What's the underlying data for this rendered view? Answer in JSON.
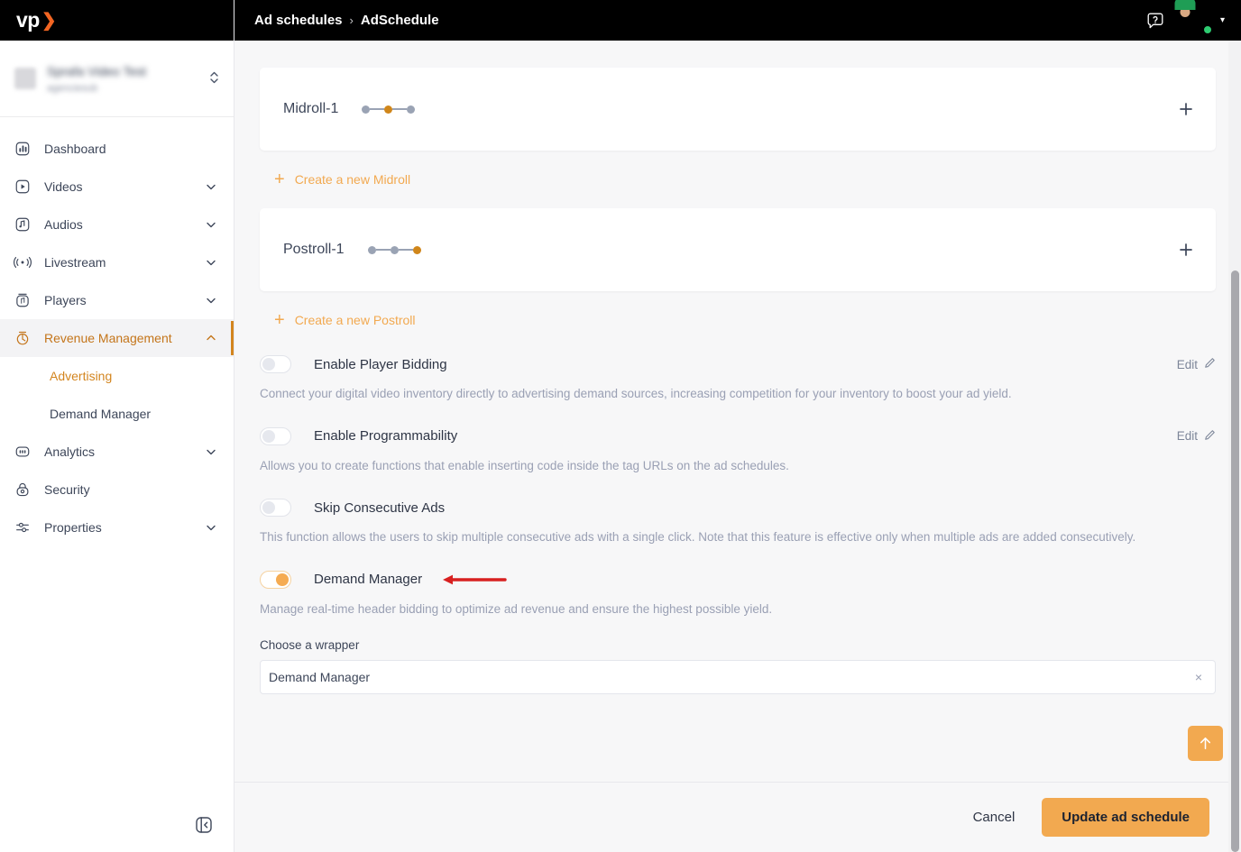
{
  "brand": {
    "logo_text": "vp",
    "logo_chevron": "❯",
    "accent": "#f2a950",
    "accent_dark": "#d3851f",
    "logo_orange": "#f26522"
  },
  "sidebar": {
    "account": {
      "name": "Sprafa Video Test",
      "sub": "agenciesub",
      "switch_icon": "chevron-updown-icon"
    },
    "items": [
      {
        "label": "Dashboard",
        "icon": "dashboard-icon",
        "expandable": false,
        "active": false
      },
      {
        "label": "Videos",
        "icon": "video-icon",
        "expandable": true,
        "active": false
      },
      {
        "label": "Audios",
        "icon": "audio-icon",
        "expandable": true,
        "active": false
      },
      {
        "label": "Livestream",
        "icon": "livestream-icon",
        "expandable": true,
        "active": false
      },
      {
        "label": "Players",
        "icon": "player-icon",
        "expandable": true,
        "active": false
      },
      {
        "label": "Revenue Management",
        "icon": "revenue-icon",
        "expandable": true,
        "active": true
      },
      {
        "label": "Analytics",
        "icon": "analytics-icon",
        "expandable": true,
        "active": false
      },
      {
        "label": "Security",
        "icon": "lock-icon",
        "expandable": false,
        "active": false
      },
      {
        "label": "Properties",
        "icon": "sliders-icon",
        "expandable": true,
        "active": false
      }
    ],
    "sub_items": [
      {
        "label": "Advertising",
        "active": true
      },
      {
        "label": "Demand Manager",
        "active": false
      }
    ],
    "collapse_icon": "panel-collapse-icon"
  },
  "topbar": {
    "breadcrumb": {
      "parent": "Ad schedules",
      "separator": "›",
      "current": "AdSchedule"
    },
    "help_icon": "help-bubble-icon",
    "avatar_icon": "user-avatar",
    "avatar_caret": "▾"
  },
  "main": {
    "rolls": [
      {
        "name": "Midroll-1",
        "position_index": 1,
        "dot_count": 3,
        "add_icon": "plus-icon"
      },
      {
        "name": "Postroll-1",
        "position_index": 2,
        "dot_count": 3,
        "add_icon": "plus-icon"
      }
    ],
    "create_links": [
      {
        "label": "Create a new Midroll",
        "icon": "plus-icon"
      },
      {
        "label": "Create a new Postroll",
        "icon": "plus-icon"
      }
    ],
    "toggles": [
      {
        "label": "Enable Player Bidding",
        "enabled": false,
        "description": "Connect your digital video inventory directly to advertising demand sources, increasing competition for your inventory to boost your ad yield.",
        "edit_label": "Edit",
        "edit_icon": "pencil-icon",
        "has_edit": true,
        "annotated": false
      },
      {
        "label": "Enable Programmability",
        "enabled": false,
        "description": "Allows you to create functions that enable inserting code inside the tag URLs on the ad schedules.",
        "edit_label": "Edit",
        "edit_icon": "pencil-icon",
        "has_edit": true,
        "annotated": false
      },
      {
        "label": "Skip Consecutive Ads",
        "enabled": false,
        "description": "This function allows the users to skip multiple consecutive ads with a single click. Note that this feature is effective only when multiple ads are added consecutively.",
        "edit_label": "",
        "edit_icon": "",
        "has_edit": false,
        "annotated": false
      },
      {
        "label": "Demand Manager",
        "enabled": true,
        "description": "Manage real-time header bidding to optimize ad revenue and ensure the highest possible yield.",
        "edit_label": "",
        "edit_icon": "",
        "has_edit": false,
        "annotated": true,
        "annotation_icon": "red-arrow-pointing-left",
        "annotation_color": "#d82020"
      }
    ],
    "wrapper_field": {
      "label": "Choose a wrapper",
      "value": "Demand Manager",
      "clear_icon": "×",
      "clear_name": "clear-selection-icon"
    },
    "scroll_top_button": {
      "icon": "arrow-up-icon",
      "glyph": "↑"
    }
  },
  "footer": {
    "cancel_label": "Cancel",
    "update_label": "Update ad schedule"
  }
}
